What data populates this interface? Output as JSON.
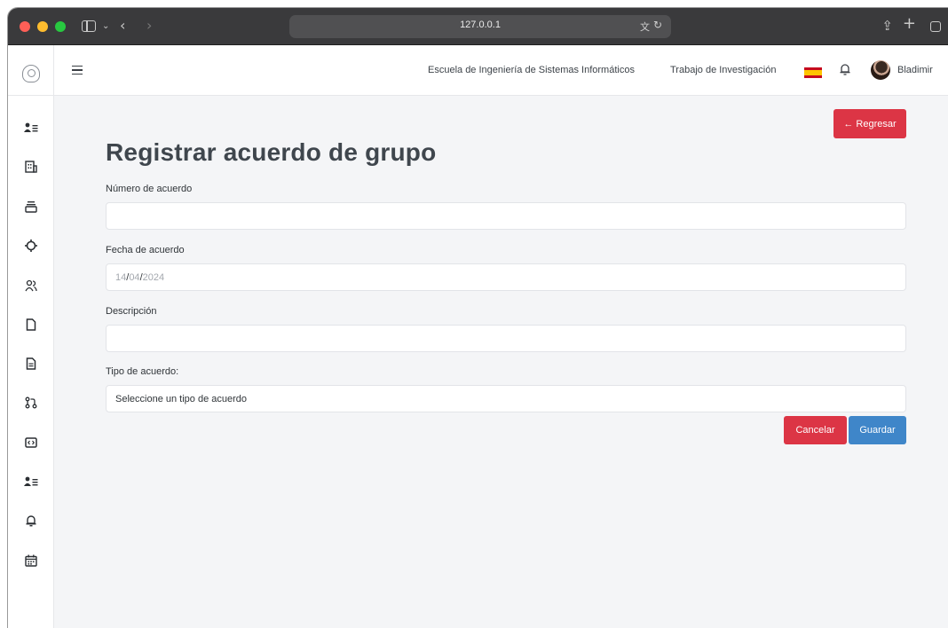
{
  "browser": {
    "url": "127.0.0.1"
  },
  "sidebar": {
    "items": [
      {
        "icon": "user-list-icon",
        "glyph": "👤≡"
      },
      {
        "icon": "building-icon",
        "glyph": "▦"
      },
      {
        "icon": "layers-icon",
        "glyph": "☰"
      },
      {
        "icon": "target-icon",
        "glyph": "◈"
      },
      {
        "icon": "users-icon",
        "glyph": "⚇"
      },
      {
        "icon": "file-icon",
        "glyph": "▢"
      },
      {
        "icon": "document-icon",
        "glyph": "▤"
      },
      {
        "icon": "git-pull-request-icon",
        "glyph": "⇅"
      },
      {
        "icon": "code-icon",
        "glyph": "▣"
      },
      {
        "icon": "user-list-icon",
        "glyph": "👤≡"
      },
      {
        "icon": "bell-icon",
        "glyph": "♫"
      },
      {
        "icon": "calendar-icon",
        "glyph": "▦"
      }
    ]
  },
  "header": {
    "school": "Escuela de Ingeniería de Sistemas Informáticos",
    "research": "Trabajo de Investigación",
    "user_name": "Bladimir"
  },
  "main": {
    "back_label": "← Regresar",
    "title": "Registrar acuerdo de grupo",
    "fields": [
      {
        "label": "Número de acuerdo",
        "value": ""
      },
      {
        "label": "Fecha de acuerdo",
        "day": "14",
        "month": "04",
        "year": "2024",
        "sep": "/"
      },
      {
        "label": "Descripción",
        "value": ""
      },
      {
        "label": "Tipo de acuerdo:",
        "selected": "Seleccione un tipo de acuerdo"
      }
    ],
    "cancel_label": "Cancelar",
    "save_label": "Guardar"
  },
  "colors": {
    "danger": "#dc3545",
    "primary": "#3f86c9"
  }
}
